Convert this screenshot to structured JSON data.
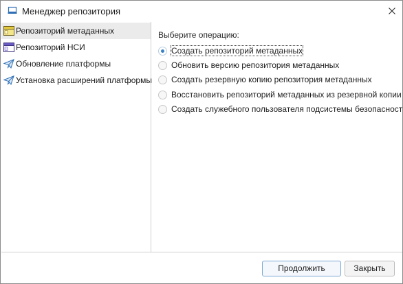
{
  "window": {
    "title": "Менеджер репозитория"
  },
  "sidebar": {
    "items": [
      {
        "label": "Репозиторий метаданных",
        "icon": "repository-metadata-icon",
        "selected": true
      },
      {
        "label": "Репозиторий НСИ",
        "icon": "repository-nsi-icon",
        "selected": false
      },
      {
        "label": "Обновление платформы",
        "icon": "paper-plane-icon",
        "selected": false
      },
      {
        "label": "Установка расширений платформы",
        "icon": "paper-plane-icon",
        "selected": false
      }
    ]
  },
  "main": {
    "operation_label": "Выберите операцию:",
    "options": [
      {
        "label": "Создать репозиторий метаданных",
        "checked": true
      },
      {
        "label": "Обновить версию репозитория метаданных",
        "checked": false
      },
      {
        "label": "Создать резервную копию репозитория метаданных",
        "checked": false
      },
      {
        "label": "Восстановить репозиторий метаданных из резервной копии",
        "checked": false
      },
      {
        "label": "Создать служебного пользователя подсистемы безопасности",
        "checked": false
      }
    ]
  },
  "footer": {
    "continue_label": "Продолжить",
    "close_label": "Закрыть"
  },
  "colors": {
    "accent": "#3a82c4",
    "selected_row": "#ebebeb",
    "border": "#8a8a8a"
  }
}
